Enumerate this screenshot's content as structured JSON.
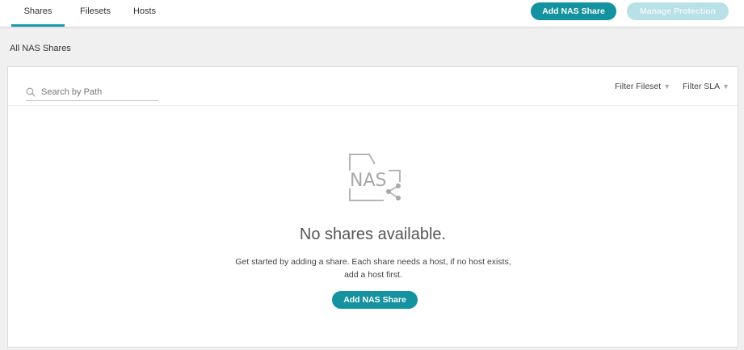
{
  "tabs": [
    {
      "label": "Shares",
      "active": true
    },
    {
      "label": "Filesets",
      "active": false
    },
    {
      "label": "Hosts",
      "active": false
    }
  ],
  "header": {
    "add_nas_share_label": "Add NAS Share",
    "manage_protection_label": "Manage Protection"
  },
  "section": {
    "title": "All NAS Shares"
  },
  "search": {
    "placeholder": "Search by Path",
    "value": ""
  },
  "filters": {
    "fileset_label": "Filter Fileset",
    "sla_label": "Filter SLA"
  },
  "empty_state": {
    "icon_text": "NAS",
    "title": "No shares available.",
    "description": "Get started by adding a share. Each share needs a host, if no host exists, add a host first.",
    "button_label": "Add NAS Share"
  },
  "colors": {
    "accent": "#14929f",
    "accent_disabled": "#b7e1e6"
  }
}
